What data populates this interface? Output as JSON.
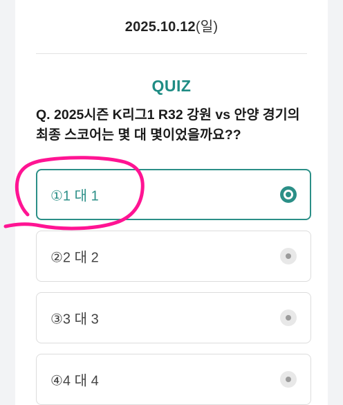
{
  "header": {
    "date": "2025.10.12",
    "day_of_week": "(일)"
  },
  "quiz": {
    "label": "QUIZ",
    "question": "Q. 2025시즌 K리그1 R32 강원 vs 안양 경기의 최종 스코어는 몇 대 몇이었을까요??",
    "selected_index": 0,
    "options": [
      {
        "label": "①1 대 1"
      },
      {
        "label": "②2 대 2"
      },
      {
        "label": "③3 대 3"
      },
      {
        "label": "④4 대 4"
      }
    ]
  },
  "colors": {
    "accent": "#2b8f87",
    "quiz_label": "#1f8c84",
    "annotation": "#ff1493",
    "border": "#dcdcdc"
  }
}
